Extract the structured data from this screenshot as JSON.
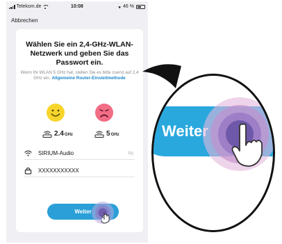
{
  "status_bar": {
    "carrier": "Telekom.de",
    "time": "10:08",
    "battery": "46 %"
  },
  "nav": {
    "cancel_label": "Abbrechen"
  },
  "heading": "Wählen Sie ein 2,4-GHz-WLAN-Netzwerk und geben Sie das Passwort ein.",
  "hint": {
    "text": "Wenn Ihr WLAN 5 GHz hat, stellen Sie es bitte zuerst auf 2,4 GHz ein.",
    "link": "Allgemeine Router-Einstellmethode"
  },
  "bands": [
    {
      "value": "2.4",
      "unit": "GHz",
      "status": "supported",
      "face_icon": "smiley-happy-icon",
      "color": "#f7d52c"
    },
    {
      "value": "5",
      "unit": "GHz",
      "status": "unsupported",
      "face_icon": "smiley-sad-icon",
      "color": "#f26d85"
    }
  ],
  "wifi_field": {
    "icon": "wifi-icon",
    "value": "SIRIUM-Audio",
    "suffix": "Bg"
  },
  "password_field": {
    "icon": "lock-icon",
    "value": "XXXXXXXXXXX"
  },
  "next_button": {
    "label": "Weiter",
    "color": "#2a9fd8"
  },
  "magnifier": {
    "button_label": "Weiter"
  },
  "colors": {
    "accent": "#2a9fd8",
    "link": "#1f86c9",
    "touch": "#6b56a8"
  }
}
